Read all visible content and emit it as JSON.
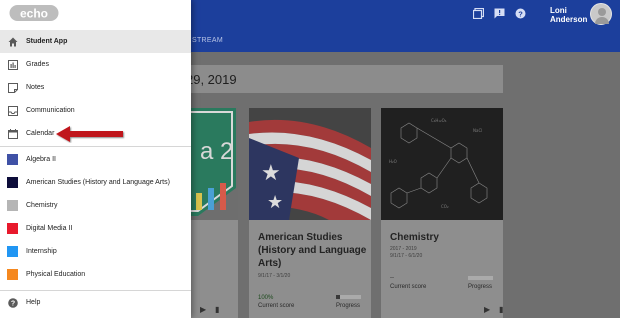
{
  "header": {
    "user_name_line1": "Loni",
    "user_name_line2": "Anderson",
    "tab_stream": "STREAM"
  },
  "main": {
    "date_partial": "29, 2019"
  },
  "cards": [
    {
      "title": "American Studies (History and Language Arts)",
      "dates": "9/1/17 - 3/1/20",
      "score": "100%",
      "score_label": "Current score",
      "progress_label": "Progress",
      "progress_fraction": 0.15
    },
    {
      "title": "Chemistry",
      "dates_line1": "2017 - 2019",
      "dates_line2": "9/1/17 - 6/1/20",
      "score": "--",
      "score_label": "Current score",
      "progress_label": "Progress",
      "progress_fraction": 0.0
    }
  ],
  "partial_card_text": "a 2",
  "drawer": {
    "logo_text": "echo",
    "items": [
      {
        "label": "Student App",
        "icon": "home-icon",
        "bold": true
      },
      {
        "label": "Grades",
        "icon": "bar-chart-icon"
      },
      {
        "label": "Notes",
        "icon": "note-icon"
      },
      {
        "label": "Communication",
        "icon": "inbox-icon"
      },
      {
        "label": "Calendar",
        "icon": "calendar-icon"
      }
    ],
    "courses": [
      {
        "label": "Algebra II",
        "color": "#3f51a6"
      },
      {
        "label": "American Studies (History and Language Arts)",
        "color": "#0d0d3a"
      },
      {
        "label": "Chemistry",
        "color": "#b5b5b5"
      },
      {
        "label": "Digital Media II",
        "color": "#e8192c"
      },
      {
        "label": "Internship",
        "color": "#2196f3"
      },
      {
        "label": "Physical Education",
        "color": "#f5881f"
      }
    ],
    "help_label": "Help"
  },
  "colors": {
    "header_blue": "#1c3f9c",
    "arrow_red": "#c0151b"
  }
}
